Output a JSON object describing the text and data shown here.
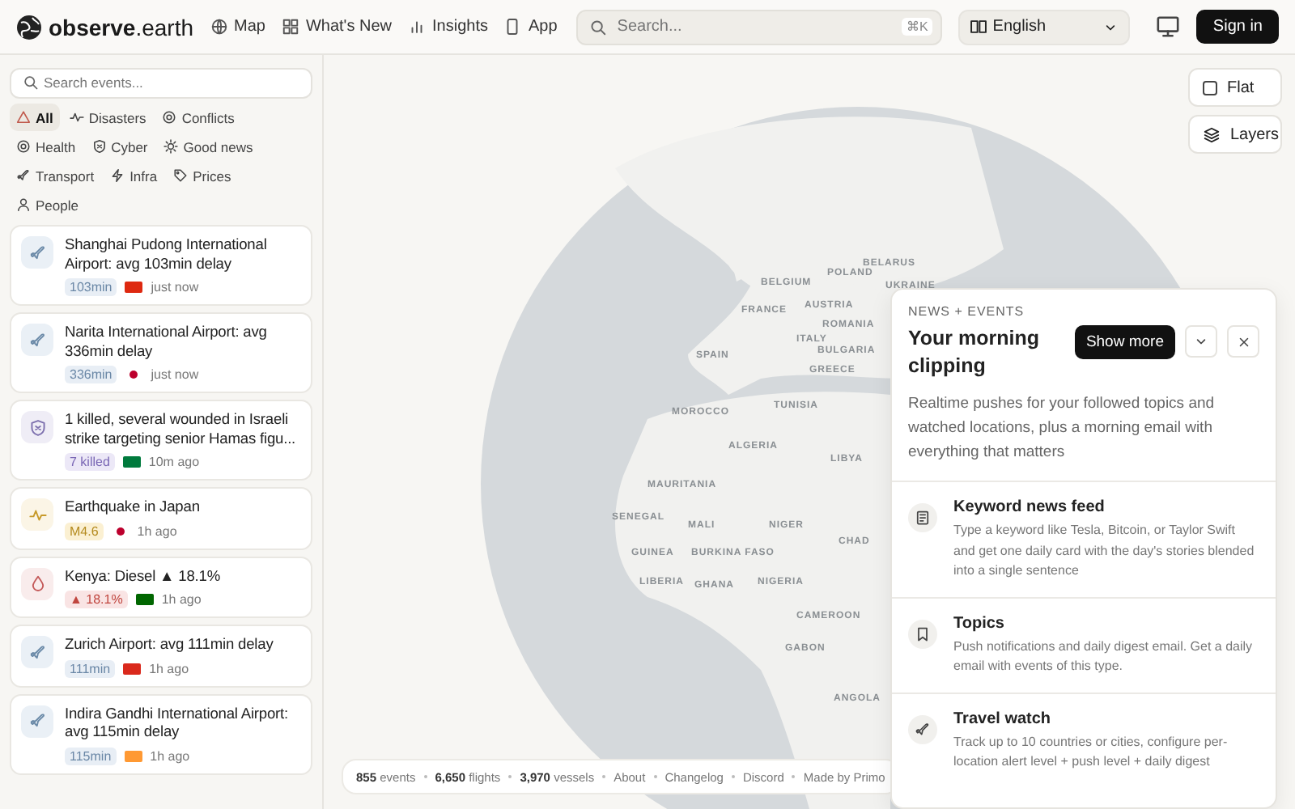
{
  "header": {
    "logo": "**observe**.earth",
    "nav": [
      {
        "label": "Map"
      },
      {
        "label": "What's New"
      },
      {
        "label": "Insights"
      },
      {
        "label": "App"
      }
    ],
    "search": {
      "placeholder": "Search...",
      "shortcut": "⌘K"
    },
    "language": {
      "value": "English"
    },
    "sign_in": "Sign in"
  },
  "sidebar": {
    "search": {
      "placeholder": "Search events..."
    },
    "filters": [
      {
        "label": "All",
        "selected": true
      },
      {
        "label": "Disasters",
        "selected": false
      },
      {
        "label": "Conflicts",
        "selected": false
      },
      {
        "label": "Health",
        "selected": false
      },
      {
        "label": "Cyber",
        "selected": false
      },
      {
        "label": "Good news",
        "selected": false
      },
      {
        "label": "Transport",
        "selected": false
      },
      {
        "label": "Infra",
        "selected": false
      },
      {
        "label": "Prices",
        "selected": false
      },
      {
        "label": "People",
        "selected": false
      }
    ],
    "events": [
      {
        "kind": "flight",
        "title": "Shanghai Pudong International Airport: avg 103min delay",
        "badge": "103min",
        "flag": {
          "kind": "rect",
          "color": "#de2910"
        },
        "time": "just now"
      },
      {
        "kind": "flight",
        "title": "Narita International Airport: avg 336min delay",
        "badge": "336min",
        "flag": {
          "kind": "dot",
          "color": "#bc002d"
        },
        "time": "just now"
      },
      {
        "kind": "conflict",
        "title": "1 killed, several wounded in Israeli strike targeting senior Hamas figu...",
        "badge": "7 killed",
        "flag": {
          "kind": "rect",
          "color": "#007a3d"
        },
        "time": "10m ago"
      },
      {
        "kind": "earthquake",
        "title": "Earthquake in Japan",
        "badge": "M4.6",
        "flag": {
          "kind": "dot",
          "color": "#bc002d"
        },
        "time": "1h ago"
      },
      {
        "kind": "price",
        "title": "Kenya: Diesel ▲ 18.1%",
        "badge": "▲ 18.1%",
        "flag": {
          "kind": "rect",
          "color": "#006600"
        },
        "time": "1h ago"
      },
      {
        "kind": "flight",
        "title": "Zurich Airport: avg 111min delay",
        "badge": "111min",
        "flag": {
          "kind": "rect",
          "color": "#da291c"
        },
        "time": "1h ago"
      },
      {
        "kind": "flight",
        "title": "Indira Gandhi International Airport: avg 115min delay",
        "badge": "115min",
        "flag": {
          "kind": "rect",
          "color": "#ff9933"
        },
        "time": "1h ago"
      }
    ]
  },
  "map": {
    "flat_toggle": {
      "label": "Flat",
      "checked": false
    },
    "layers": "Layers",
    "labels": [
      "BELARUS",
      "POLAND",
      "UKRAINE",
      "BELGIUM",
      "FRANCE",
      "AUSTRIA",
      "ROMANIA",
      "ITALY",
      "BULGARIA",
      "SPAIN",
      "GREECE",
      "MOROCCO",
      "TUNISIA",
      "ALGERIA",
      "LIBYA",
      "MAURITANIA",
      "SENEGAL",
      "MALI",
      "NIGER",
      "CHAD",
      "GUINEA",
      "BURKINA FASO",
      "LIBERIA",
      "GHANA",
      "NIGERIA",
      "CAMEROON",
      "GABON",
      "ANGOLA"
    ]
  },
  "footer": [
    {
      "number": "855",
      "text": "events"
    },
    {
      "number": "6,650",
      "text": "flights"
    },
    {
      "number": "3,970",
      "text": "vessels"
    },
    {
      "text": "About"
    },
    {
      "text": "Changelog"
    },
    {
      "text": "Discord"
    },
    {
      "text": "Made by Primo"
    }
  ],
  "popup": {
    "eyebrow": "NEWS + EVENTS",
    "title": "Your morning clipping",
    "show_more": "Show more",
    "description": "Realtime pushes for your followed topics and watched locations, plus a morning email with everything that matters",
    "features": [
      {
        "title": "Keyword news feed",
        "text": "Type a keyword like Tesla, Bitcoin, or Taylor Swift and get one daily card with the day's stories blended into a single sentence"
      },
      {
        "title": "Topics",
        "text": "Push notifications and daily digest email. Get a daily email with events of this type."
      },
      {
        "title": "Travel watch",
        "text": "Track up to 10 countries or cities, configure per-location alert level + push level + daily digest"
      }
    ]
  }
}
